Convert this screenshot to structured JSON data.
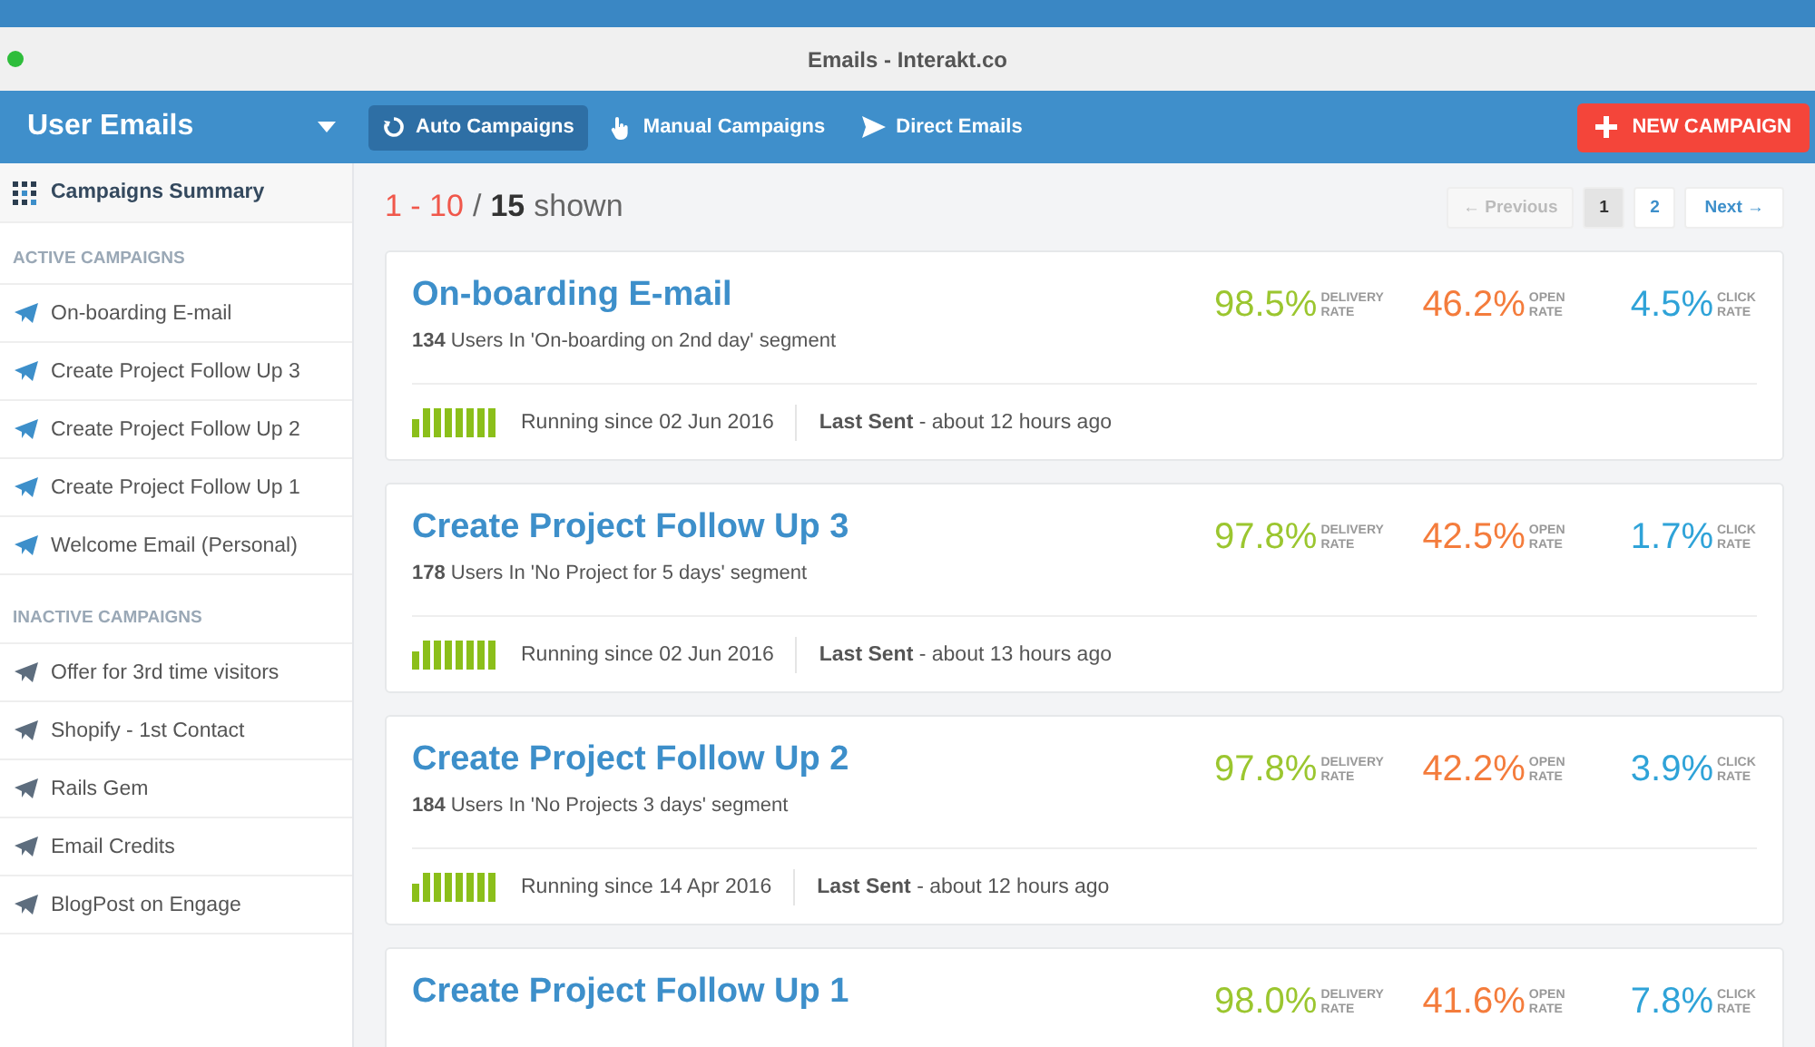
{
  "window": {
    "title": "Emails - Interakt.co"
  },
  "header": {
    "title": "User Emails",
    "tabs": [
      {
        "label": "Auto Campaigns",
        "selected": true
      },
      {
        "label": "Manual Campaigns",
        "selected": false
      },
      {
        "label": "Direct Emails",
        "selected": false
      }
    ],
    "new_button": "NEW CAMPAIGN"
  },
  "sidebar": {
    "summary": "Campaigns Summary",
    "sections": [
      {
        "title": "ACTIVE CAMPAIGNS",
        "active": true,
        "items": [
          "On-boarding E-mail",
          "Create Project Follow Up 3",
          "Create Project Follow Up 2",
          "Create Project Follow Up 1",
          "Welcome Email (Personal)"
        ]
      },
      {
        "title": "INACTIVE CAMPAIGNS",
        "active": false,
        "items": [
          "Offer for 3rd time visitors",
          "Shopify - 1st Contact",
          "Rails Gem",
          "Email Credits",
          "BlogPost on Engage"
        ]
      }
    ]
  },
  "listing": {
    "range": "1 - 10",
    "separator": "/",
    "total": "15",
    "suffix": "shown"
  },
  "pagination": [
    {
      "label": "← Previous",
      "kind": "prev",
      "disabled": true,
      "selected": false
    },
    {
      "label": "1",
      "kind": "page",
      "disabled": false,
      "selected": true
    },
    {
      "label": "2",
      "kind": "page",
      "disabled": false,
      "selected": false
    },
    {
      "label": "Next →",
      "kind": "next",
      "disabled": false,
      "selected": false
    }
  ],
  "campaigns": [
    {
      "name": "On-boarding E-mail",
      "segment": "**134** Users In 'On-boarding on 2nd day' segment",
      "running": "Running since 02 Jun 2016",
      "last_sent": "**Last Sent** - about 12 hours ago",
      "metrics": [
        {
          "value": "98.5%",
          "label": "DELIVERY RATE",
          "color": "#9bc62f"
        },
        {
          "value": "46.2%",
          "label": "OPEN RATE",
          "color": "#f47c3c"
        },
        {
          "value": "4.5%",
          "label": "CLICK RATE",
          "color": "#2fa3d8"
        }
      ]
    },
    {
      "name": "Create Project Follow Up 3",
      "segment": "**178** Users In 'No Project for 5 days' segment",
      "running": "Running since 02 Jun 2016",
      "last_sent": "**Last Sent** - about 13 hours ago",
      "metrics": [
        {
          "value": "97.8%",
          "label": "DELIVERY RATE",
          "color": "#9bc62f"
        },
        {
          "value": "42.5%",
          "label": "OPEN RATE",
          "color": "#f47c3c"
        },
        {
          "value": "1.7%",
          "label": "CLICK RATE",
          "color": "#2fa3d8"
        }
      ]
    },
    {
      "name": "Create Project Follow Up 2",
      "segment": "**184** Users In 'No Projects 3 days' segment",
      "running": "Running since 14 Apr 2016",
      "last_sent": "**Last Sent** - about 12 hours ago",
      "metrics": [
        {
          "value": "97.8%",
          "label": "DELIVERY RATE",
          "color": "#9bc62f"
        },
        {
          "value": "42.2%",
          "label": "OPEN RATE",
          "color": "#f47c3c"
        },
        {
          "value": "3.9%",
          "label": "CLICK RATE",
          "color": "#2fa3d8"
        }
      ]
    },
    {
      "name": "Create Project Follow Up 1",
      "metrics": [
        {
          "value": "98.0%",
          "label": "DELIVERY RATE",
          "color": "#9bc62f"
        },
        {
          "value": "41.6%",
          "label": "OPEN RATE",
          "color": "#f47c3c"
        },
        {
          "value": "7.8%",
          "label": "CLICK RATE",
          "color": "#2fa3d8"
        }
      ]
    }
  ]
}
